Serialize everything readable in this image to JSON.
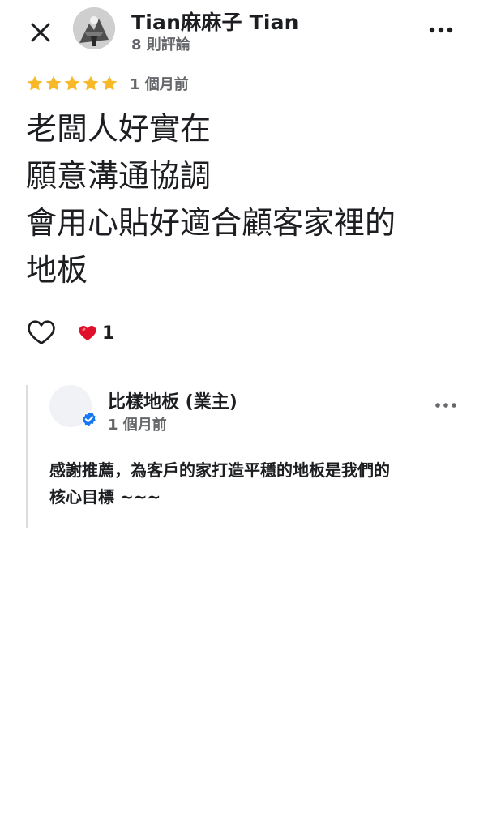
{
  "header": {
    "reviewer_name": "Tian麻麻子 Tian",
    "review_count": "8 則評論"
  },
  "rating": {
    "stars": 5,
    "time": "1 個月前",
    "star_color": "#f7b928"
  },
  "review": {
    "lines": [
      "老闆人好實在",
      "願意溝通協調",
      "會用心貼好適合顧客家裡的",
      "地板"
    ]
  },
  "reactions": {
    "count": "1"
  },
  "owner_reply": {
    "name": "比樣地板 (業主)",
    "time": "1 個月前",
    "lines": [
      "感謝推薦，為客戶的家打造平穩的地板是我們的",
      "核心目標 ~~~"
    ],
    "verified_color": "#1877f2"
  }
}
